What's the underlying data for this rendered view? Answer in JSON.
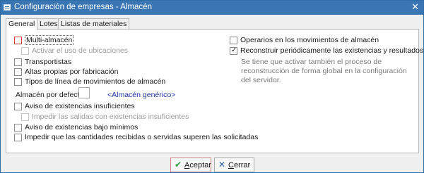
{
  "window": {
    "title": "Configuración de empresas - Almacén",
    "close_glyph": "✕",
    "icon": "window-app-icon"
  },
  "tabs": [
    {
      "label": "General",
      "active": true
    },
    {
      "label": "Lotes",
      "active": false
    },
    {
      "label": "Listas de materiales",
      "active": false
    }
  ],
  "left_options": [
    {
      "label": "Multi-almacén",
      "checked": false,
      "enabled": true
    },
    {
      "label": "Activar el uso de ubicaciones",
      "checked": false,
      "enabled": false
    },
    {
      "label": "Transportistas",
      "checked": false,
      "enabled": true
    },
    {
      "label": "Altas propias por fabricación",
      "checked": false,
      "enabled": true
    },
    {
      "label": "Tipos de línea de movimientos de almacén",
      "checked": false,
      "enabled": true
    }
  ],
  "almacen": {
    "label": "Almacén por defecto",
    "value": "",
    "link": "<Almacén genérico>"
  },
  "bottom_options": [
    {
      "label": "Aviso de existencias insuficientes",
      "checked": false,
      "enabled": true
    },
    {
      "label": "Impedir las salidas con existencias insuficientes",
      "checked": false,
      "enabled": false
    },
    {
      "label": "Aviso de existencias bajo mínimos",
      "checked": false,
      "enabled": true
    },
    {
      "label": "Impedir que las cantidades recibidas o servidas superen las solicitadas",
      "checked": false,
      "enabled": true
    }
  ],
  "right_options": [
    {
      "label": "Operarios en los movimientos de almacén",
      "checked": false,
      "enabled": true
    },
    {
      "label": "Reconstruir periódicamente las existencias y resultados",
      "checked": true,
      "enabled": true
    }
  ],
  "note": "Se tiene que activar también el proceso de reconstrucción de forma global en la configuración del servidor.",
  "buttons": {
    "accept": {
      "underline": "A",
      "rest": "ceptar",
      "icon": "checkmark-icon",
      "glyph": "✔",
      "color": "#2e9e3e"
    },
    "cancel": {
      "underline": "C",
      "rest": "errar",
      "icon": "close-icon",
      "glyph": "✕",
      "color": "#2a5fa8"
    }
  }
}
